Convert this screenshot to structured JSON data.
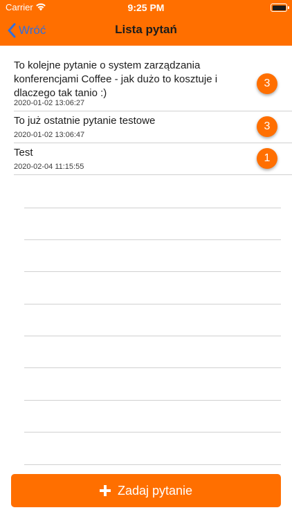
{
  "status_bar": {
    "carrier": "Carrier",
    "time": "9:25 PM",
    "wifi_icon": "wifi-icon",
    "battery_icon": "battery-icon"
  },
  "nav": {
    "back_label": "Wróć",
    "back_icon": "chevron-left-icon",
    "title": "Lista pytań"
  },
  "questions": [
    {
      "text": "To kolejne pytanie o system zarządzania konferencjami Coffee - jak dużo to kosztuje i dlaczego tak tanio :)",
      "date": "2020-01-02 13:06:27",
      "count": "3"
    },
    {
      "text": "To już ostatnie pytanie testowe",
      "date": "2020-01-02 13:06:47",
      "count": "3"
    },
    {
      "text": "Test",
      "date": "2020-02-04 11:15:55",
      "count": "1"
    }
  ],
  "ask_button": {
    "label": "Zadaj pytanie",
    "icon": "plus-icon"
  },
  "colors": {
    "accent": "#FF6F00",
    "link": "#2F6FE0",
    "separator": "#D0D0D0"
  }
}
